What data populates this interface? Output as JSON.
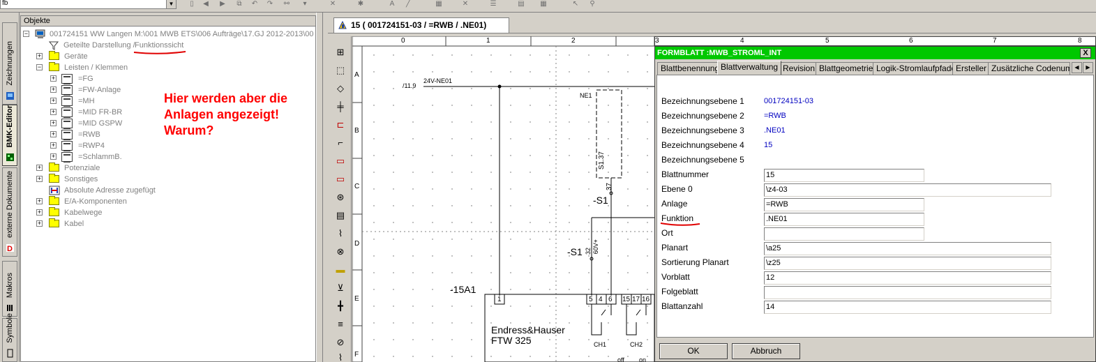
{
  "toolbar": {
    "combo_value": "fb",
    "icons": [
      "page-icon",
      "undo-icon",
      "redo-icon",
      "copy-icon",
      "rotate-left-icon",
      "rotate-right-icon",
      "link-icon",
      "cross-icon",
      "text-icon",
      "line-icon",
      "grid-icon",
      "align-icon",
      "symbol-icon",
      "cursor-icon",
      "binoculars-icon"
    ]
  },
  "vertical_tabs": [
    {
      "label": "Zeichnungen",
      "icon": "drawings-icon"
    },
    {
      "label": "BMK-Editor",
      "icon": "bmk-editor-icon"
    },
    {
      "label": "externe Dokumente",
      "icon": "pdf-icon"
    },
    {
      "label": "Makros",
      "icon": "macros-icon"
    },
    {
      "label": "Symbole",
      "icon": "symbols-icon"
    }
  ],
  "tree": {
    "header": "Objekte",
    "root": "001724151 WW Langen M:\\001 MWB ETS\\006 Aufträge\\17.GJ 2012-2013\\00",
    "view_prefix": "Geteilte Darstellung / ",
    "view_link": "Funktionssicht",
    "geraete": "Geräte",
    "leisten": "Leisten / Klemmen",
    "anlagen": [
      "=FG",
      "=FW-Anlage",
      "=MH",
      "=MID FR-BR",
      "=MID GSPW",
      "=RWB",
      "=RWP4",
      "=SchlammB."
    ],
    "potenziale": "Potenziale",
    "sonstiges": "Sonstiges",
    "absolute": "Absolute Adresse zugefügt",
    "ea": "E/A-Komponenten",
    "kabelwege": "Kabelwege",
    "kabel": "Kabel"
  },
  "annotation": {
    "line1": "Hier werden aber die",
    "line2": "Anlagen angezeigt!",
    "line3": "Warum?"
  },
  "document_tab": "15 ( 001724151-03  / =RWB  / .NE01)",
  "drawing": {
    "columns": [
      "0",
      "1",
      "2",
      "3",
      "4",
      "5",
      "6",
      "7",
      "8"
    ],
    "rows": [
      "A",
      "B",
      "C",
      "D",
      "E",
      "F"
    ],
    "net_ref": "/11.9",
    "net": "24V-NE01",
    "ne1": "NE1",
    "s137": "S1.37",
    "pin37": "37",
    "s1": "-S1",
    "s1b": "-S1",
    "pin32": "32",
    "v60": "60V+",
    "a151": "-15A1",
    "pin1": "1",
    "pins": [
      "5",
      "4",
      "6",
      "15",
      "17",
      "16"
    ],
    "maker": "Endress&Hauser",
    "model": "FTW 325",
    "ch1": "CH1",
    "ch2": "CH2",
    "off": "off",
    "on": "on"
  },
  "form": {
    "title": "FORMBLATT :MWB_STROML_INT",
    "close": "X",
    "tabs": [
      "Blattbenennung",
      "Blattverwaltung",
      "Revision",
      "Blattgeometrie",
      "Logik-Stromlaufpfade",
      "Ersteller",
      "Zusätzliche Codenumm"
    ],
    "active_tab": "Blattverwaltung",
    "fields": [
      {
        "label": "Bezeichnungsebene 1",
        "value": "001724151-03"
      },
      {
        "label": "Bezeichnungsebene 2",
        "value": "=RWB"
      },
      {
        "label": "Bezeichnungsebene 3",
        "value": ".NE01"
      },
      {
        "label": "Bezeichnungsebene 4",
        "value": "15"
      },
      {
        "label": "Bezeichnungsebene 5",
        "value": ""
      }
    ],
    "inputs": [
      {
        "label": "Blattnummer",
        "value": "15"
      },
      {
        "label": "Ebene 0",
        "value": "\\z4-03"
      },
      {
        "label": "Anlage",
        "value": "=RWB"
      },
      {
        "label": "Funktion",
        "value": ".NE01"
      },
      {
        "label": "Ort",
        "value": ""
      },
      {
        "label": "Planart",
        "value": "\\a25"
      },
      {
        "label": "Sortierung Planart",
        "value": "\\z25"
      },
      {
        "label": "Vorblatt",
        "value": "12"
      },
      {
        "label": "Folgeblatt",
        "value": ""
      },
      {
        "label": "Blattanzahl",
        "value": "14"
      }
    ],
    "ok": "OK",
    "cancel": "Abbruch"
  },
  "colors": {
    "annotation": "#ff0000",
    "form_title_bg": "#00c800",
    "value_blue": "#0000c0"
  }
}
